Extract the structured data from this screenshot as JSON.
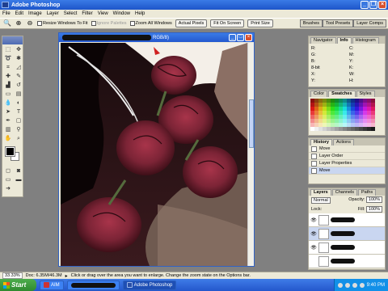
{
  "app": {
    "title": "Adobe Photoshop"
  },
  "menu": [
    "File",
    "Edit",
    "Image",
    "Layer",
    "Select",
    "Filter",
    "View",
    "Window",
    "Help"
  ],
  "options": {
    "resize_windows": "Resize Windows To Fit",
    "ignore_palettes": "Ignore Palettes",
    "zoom_all": "Zoom All Windows",
    "actual_pixels": "Actual Pixels",
    "fit_on_screen": "Fit On Screen",
    "print_size": "Print Size"
  },
  "well_tabs": [
    "Brushes",
    "Tool Presets",
    "Layer Comps"
  ],
  "document": {
    "title_suffix": "RGB/8)"
  },
  "navigator": {
    "tabs": [
      "Navigator",
      "Info",
      "Histogram"
    ],
    "labels": [
      "R:",
      "C:",
      "G:",
      "M:",
      "B:",
      "Y:",
      "8-bit",
      "K:",
      "X:",
      "W:",
      "Y:",
      "H:"
    ]
  },
  "color": {
    "tabs": [
      "Color",
      "Swatches",
      "Styles"
    ]
  },
  "history": {
    "tabs": [
      "History",
      "Actions"
    ],
    "items": [
      "Move",
      "Layer Order",
      "Layer Properties",
      "Move"
    ]
  },
  "layers": {
    "tabs": [
      "Layers",
      "Channels",
      "Paths"
    ],
    "mode": "Normal",
    "opacity_label": "Opacity:",
    "opacity": "100%",
    "fill_label": "Fill:",
    "fill": "100%",
    "lock_label": "Lock:"
  },
  "status": {
    "zoom": "33.33%",
    "doc": "Doc: 6.35M/46.3M",
    "hint": "Click or drag over the area you want to enlarge. Change the zoom state on the Options bar."
  },
  "taskbar": {
    "start": "Start",
    "aim": "AIM",
    "photoshop": "Adobe Photoshop",
    "clock": "9:40 PM"
  }
}
